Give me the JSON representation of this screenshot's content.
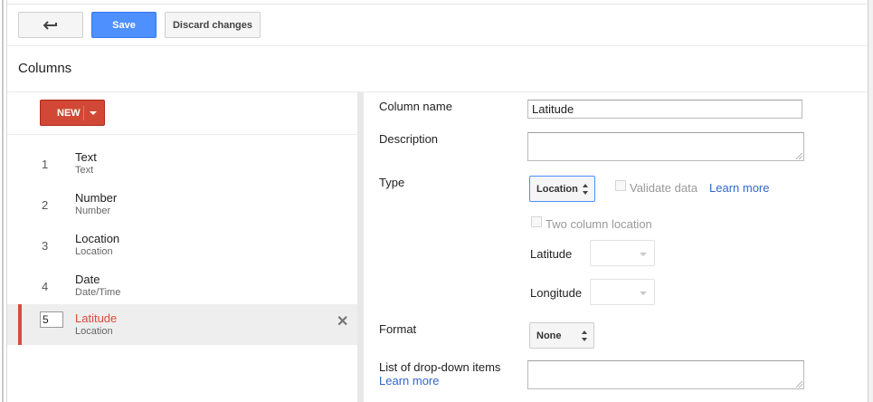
{
  "toolbar": {
    "back_icon": "back-arrow-icon",
    "save_label": "Save",
    "discard_label": "Discard changes"
  },
  "section_title": "Columns",
  "new_button": {
    "label": "NEW",
    "icon": "caret-down-icon"
  },
  "columns": [
    {
      "num": "1",
      "name": "Text",
      "type": "Text"
    },
    {
      "num": "2",
      "name": "Number",
      "type": "Number"
    },
    {
      "num": "3",
      "name": "Location",
      "type": "Location"
    },
    {
      "num": "4",
      "name": "Date",
      "type": "Date/Time"
    },
    {
      "num": "5",
      "name": "Latitude",
      "type": "Location",
      "selected": true
    }
  ],
  "form": {
    "column_name_label": "Column name",
    "column_name_value": "Latitude",
    "description_label": "Description",
    "description_value": "",
    "type_label": "Type",
    "type_value": "Location",
    "validate_data_label": "Validate data",
    "learn_more_label": "Learn more",
    "two_column_location_label": "Two column location",
    "latitude_label": "Latitude",
    "longitude_label": "Longitude",
    "format_label": "Format",
    "format_value": "None",
    "dropdown_items_label": "List of drop-down items",
    "dropdown_learn_more_label": "Learn more"
  },
  "colors": {
    "save_blue": "#4d90fe",
    "new_red": "#d14836",
    "selected_red": "#dd4b39",
    "link_blue": "#3366cc"
  }
}
